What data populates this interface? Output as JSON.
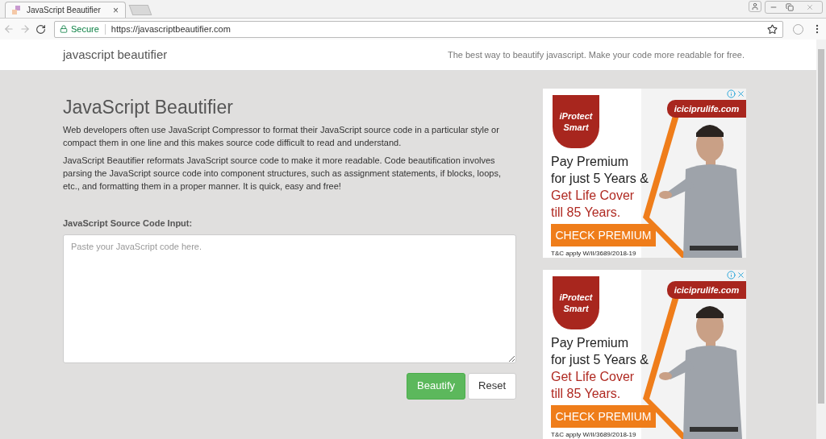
{
  "browser": {
    "tab_title": "JavaScript Beautifier",
    "tab_close": "×",
    "secure_label": "Secure",
    "url": "https://javascriptbeautifier.com"
  },
  "header": {
    "logo": "javascript beautifier",
    "tagline": "The best way to beautify javascript. Make your code more readable for free."
  },
  "main": {
    "title": "JavaScript Beautifier",
    "paragraphs": [
      "Web developers often use JavaScript Compressor to format their JavaScript source code in a particular style or compact them in one line and this makes source code difficult to read and understand.",
      "JavaScript Beautifier reformats JavaScript source code to make it more readable. Code beautification involves parsing the JavaScript source code into component structures, such as assignment statements, if blocks, loops, etc., and formatting them in a proper manner. It is quick, easy and free!"
    ],
    "input_label": "JavaScript Source Code Input:",
    "input": {
      "placeholder": "Paste your JavaScript code here."
    },
    "buttons": [
      {
        "label": "Beautify",
        "kind": "primary"
      },
      {
        "label": "Reset",
        "kind": "default"
      }
    ]
  },
  "ads": [
    {
      "badge_top": "iProtect",
      "badge_bottom": "Smart",
      "site": "iciciprulife.com",
      "lines": [
        "Pay Premium",
        "for just 5 Years &"
      ],
      "accent_lines": [
        "Get Life Cover",
        "till 85 Years."
      ],
      "cta": "CHECK PREMIUM",
      "fine_print": "T&C apply W/II/3689/2018-19"
    },
    {
      "badge_top": "iProtect",
      "badge_bottom": "Smart",
      "site": "iciciprulife.com",
      "lines": [
        "Pay Premium",
        "for just 5 Years &"
      ],
      "accent_lines": [
        "Get Life Cover",
        "till 85 Years."
      ],
      "cta": "CHECK PREMIUM",
      "fine_print": "T&C apply W/II/3689/2018-19"
    }
  ]
}
